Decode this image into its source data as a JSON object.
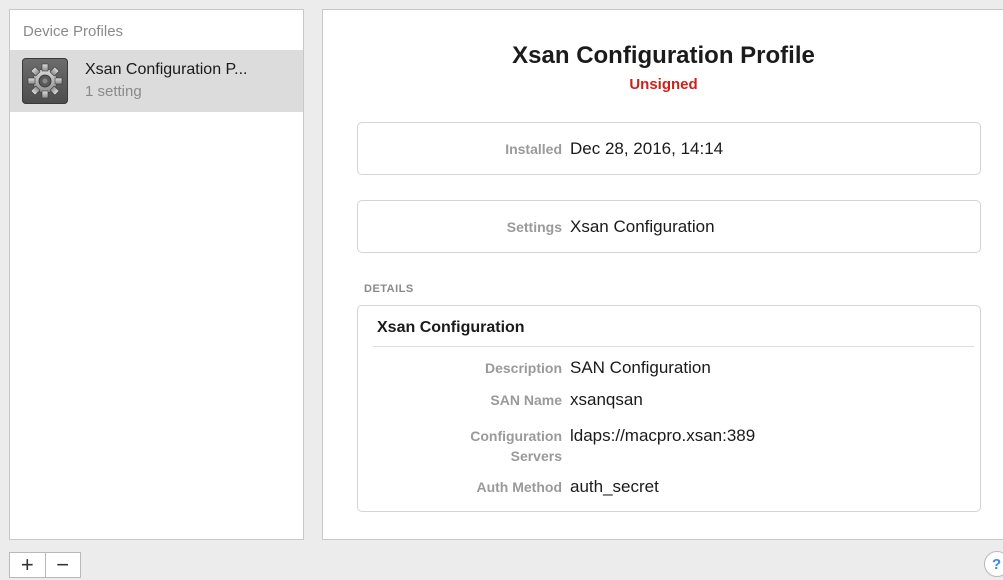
{
  "sidebar": {
    "header": "Device Profiles",
    "items": [
      {
        "title": "Xsan Configuration P...",
        "subtitle": "1 setting",
        "icon": "gear-profile-icon"
      }
    ]
  },
  "profile": {
    "title": "Xsan Configuration Profile",
    "status": "Unsigned",
    "status_color": "#d0201a",
    "installed_label": "Installed",
    "installed_value": "Dec 28, 2016, 14:14",
    "settings_label": "Settings",
    "settings_value": "Xsan Configuration"
  },
  "details": {
    "caption": "DETAILS",
    "title": "Xsan Configuration",
    "rows": [
      {
        "label": "Description",
        "value": "SAN Configuration"
      },
      {
        "label": "SAN Name",
        "value": "xsanqsan"
      },
      {
        "label_line1": "Configuration",
        "label_line2": "Servers",
        "value": "ldaps://macpro.xsan:389"
      },
      {
        "label": "Auth Method",
        "value": "auth_secret"
      }
    ]
  },
  "toolbar": {
    "add_label": "+",
    "remove_label": "−",
    "help_label": "?"
  },
  "colors": {
    "window_bg": "#ececec",
    "selected_row": "#dcdcdc",
    "help_accent": "#3b82f6"
  }
}
